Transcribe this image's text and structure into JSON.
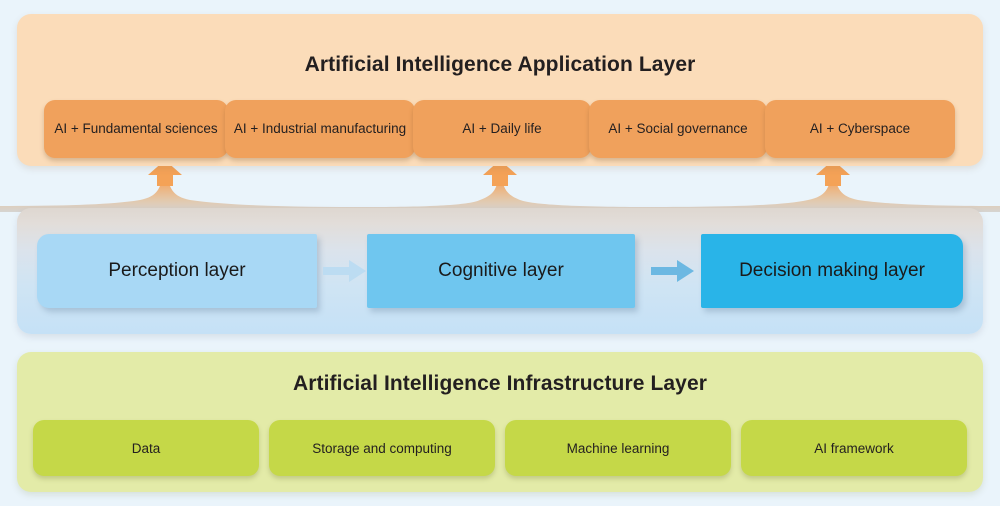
{
  "diagram": {
    "background_color": "#eaf4fb",
    "layers": [
      {
        "id": "application",
        "title": "Artificial Intelligence Application Layer",
        "panel_color": "#fbdcb9",
        "chip_color": "#f0a15c",
        "chips": [
          {
            "label": "AI + Fundamental sciences"
          },
          {
            "label": "AI + Industrial manufacturing"
          },
          {
            "label": "AI + Daily life"
          },
          {
            "label": "AI + Social governance"
          },
          {
            "label": "AI + Cyberspace"
          }
        ]
      },
      {
        "id": "core",
        "title": "",
        "panel_color": "#cfe4f4",
        "boxes": [
          {
            "label": "Perception layer",
            "color": "#a8d8f5"
          },
          {
            "label": "Cognitive layer",
            "color": "#6fc6ef"
          },
          {
            "label": "Decision making layer",
            "color": "#29b4e8"
          }
        ],
        "flow_arrows": 2,
        "rising_arrows": 3,
        "rising_arrow_color": "#f0a15c"
      },
      {
        "id": "infrastructure",
        "title": "Artificial Intelligence Infrastructure Layer",
        "panel_color": "#e3eba8",
        "chip_color": "#c5d848",
        "chips": [
          {
            "label": "Data"
          },
          {
            "label": "Storage and computing"
          },
          {
            "label": "Machine learning"
          },
          {
            "label": "AI framework"
          }
        ]
      }
    ]
  }
}
